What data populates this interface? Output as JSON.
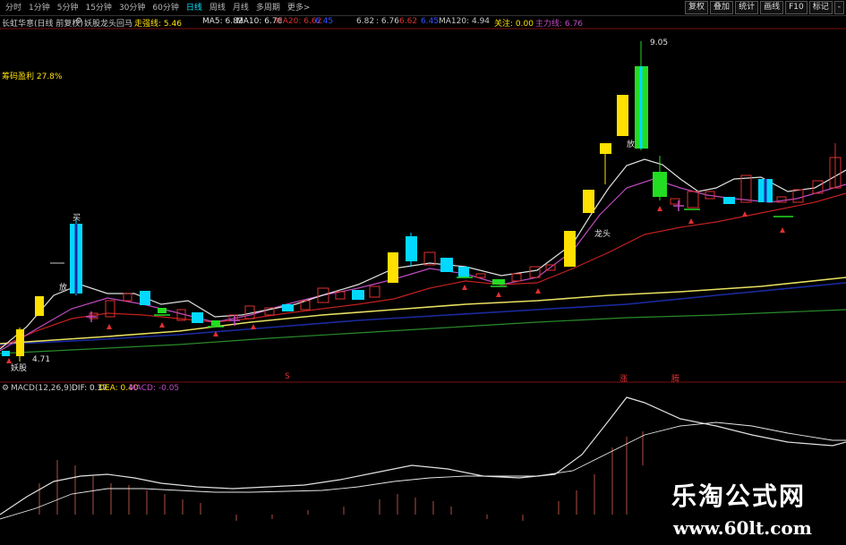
{
  "toolbar": {
    "periods": [
      "分时",
      "1分钟",
      "5分钟",
      "15分钟",
      "30分钟",
      "60分钟",
      "日线",
      "周线",
      "月线",
      "多周期",
      "更多>"
    ],
    "active_period": "日线",
    "buttons": [
      "复权",
      "叠加",
      "统计",
      "画线",
      "F10",
      "标记",
      "-"
    ]
  },
  "info": {
    "stock": "长虹华意(日线 前复权)",
    "indicator": "妖股龙头回马",
    "zhuangli": "走强线: 5.46",
    "ma5": "MA5: 6.82",
    "ma10": "MA10: 6.76",
    "ma20": "MA20: 6.62",
    "ma30": "6.45",
    "ma60a": "6.82",
    "ma60b": ": 6.76",
    "ma90": "6.62",
    "ma100": "6.45",
    "ma120": "MA120: 4.94",
    "guanzhu": "关注: 0.00",
    "zhuli": "主力线: 6.76"
  },
  "labels": {
    "chouma": "筹码盈利 27.8%",
    "high_price": "9.05",
    "low_price": "4.71",
    "yaogu": "妖股",
    "buy_mark": "买",
    "longtou": "龙头",
    "fang_a": "放",
    "fang_b": "放",
    "zhang": "涨",
    "teng": "腾",
    "s_mark": "S"
  },
  "macd": {
    "title": "MACD(12,26,9)",
    "dif": "DIF: 0.37",
    "dea": "DEA: 0.40",
    "macd": "MACD: -0.05"
  },
  "watermark": {
    "title": "乐淘公式网",
    "url": "www.60lt.com"
  },
  "colors": {
    "ma5": "#e0e0e0",
    "ma10": "#c04bc0",
    "ma20": "#c02020",
    "ma60": "#e8e060",
    "ma120": "#1a2aa0",
    "ma250": "#2a8a2a",
    "up_candle": "#e03030",
    "yellow_candle": "#ffe000",
    "cyan_candle": "#00d8ff",
    "green_candle": "#22dd22"
  }
}
